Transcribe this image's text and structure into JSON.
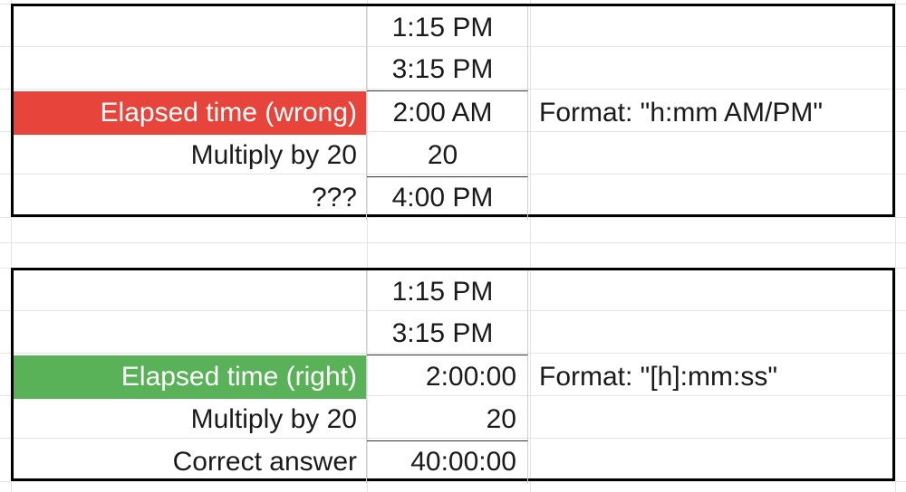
{
  "wrong": {
    "r1": {
      "label": "",
      "value": "1:15 PM",
      "note": ""
    },
    "r2": {
      "label": "",
      "value": "3:15 PM",
      "note": ""
    },
    "r3": {
      "label": "Elapsed time (wrong)",
      "value": "2:00 AM",
      "note": "Format: \"h:mm AM/PM\""
    },
    "r4": {
      "label": "Multiply by 20",
      "value": "20",
      "note": ""
    },
    "r5": {
      "label": "???",
      "value": "4:00 PM",
      "note": ""
    }
  },
  "right": {
    "r1": {
      "label": "",
      "value": "1:15 PM",
      "note": ""
    },
    "r2": {
      "label": "",
      "value": "3:15 PM",
      "note": ""
    },
    "r3": {
      "label": "Elapsed time (right)",
      "value": "2:00:00",
      "note": "Format: \"[h]:mm:ss\""
    },
    "r4": {
      "label": "Multiply by 20",
      "value": "20",
      "note": ""
    },
    "r5": {
      "label": "Correct answer",
      "value": "40:00:00",
      "note": ""
    }
  },
  "colors": {
    "red": "#e7453c",
    "green": "#59b158"
  }
}
